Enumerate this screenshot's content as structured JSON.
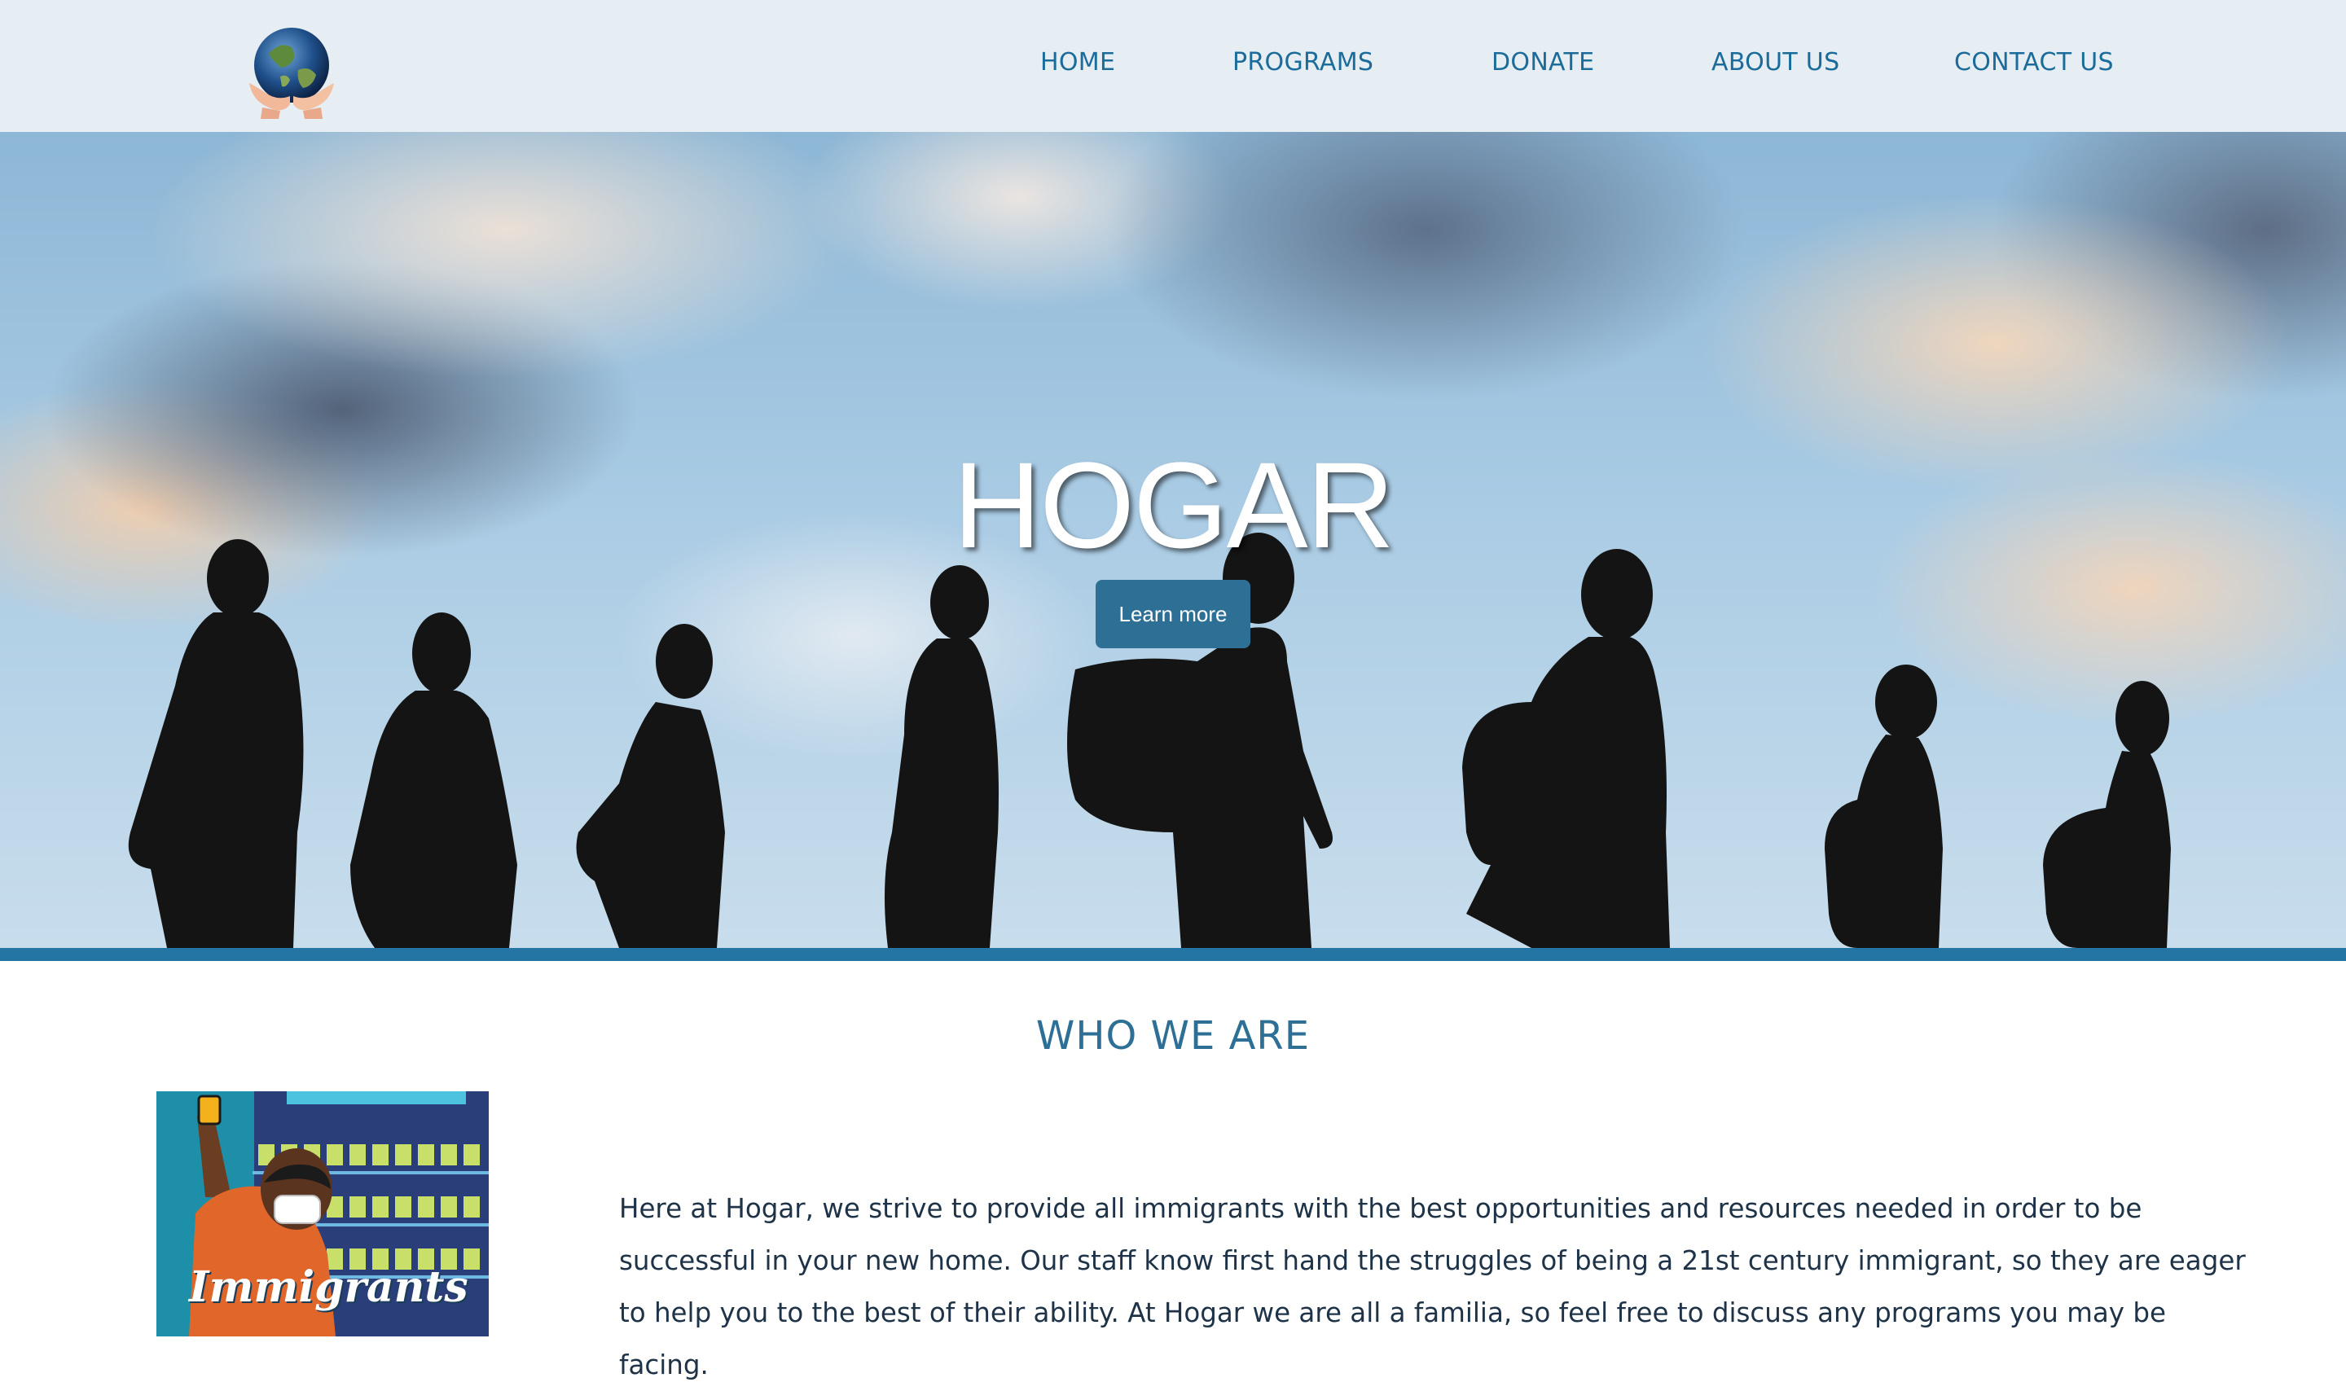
{
  "nav": {
    "items": [
      "HOME",
      "PROGRAMS",
      "DONATE",
      "ABOUT US",
      "CONTACT US"
    ]
  },
  "hero": {
    "title": "HOGAR",
    "button_label": "Learn more"
  },
  "about": {
    "heading": "WHO WE ARE",
    "poster_text": "Immigrants",
    "paragraph": "Here at Hogar, we strive to provide all immigrants with the best opportunities and resources needed in order to be successful in your new home. Our staff know first hand the struggles of being a 21st century immigrant, so they are eager to help you to the best of their ability. At Hogar we are all a familia, so feel free to discuss any programs you may be facing."
  },
  "colors": {
    "header_bg": "#e6eef3",
    "nav_text": "#1b6c9b",
    "accent": "#2e6f96",
    "bar": "#2474a4",
    "body_text": "#1e3347"
  },
  "icons": {
    "logo": "globe-in-hands-icon"
  }
}
